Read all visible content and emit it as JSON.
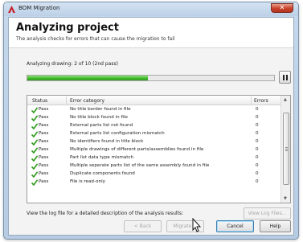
{
  "window": {
    "title": "BOM Migration",
    "close_glyph": "✕"
  },
  "header": {
    "title": "Analyzing project",
    "subtitle": "The analysis checks for errors that can cause the migration to fail"
  },
  "progress": {
    "label": "Analyzing drawing: 2 of 10 (2nd pass)",
    "fraction": 0.49
  },
  "table": {
    "columns": {
      "status": "Status",
      "category": "Error category",
      "errors": "Errors"
    },
    "rows": [
      {
        "status": "Pass",
        "category": "No title border found in file",
        "errors": "0"
      },
      {
        "status": "Pass",
        "category": "No title block found in file",
        "errors": "0"
      },
      {
        "status": "Pass",
        "category": "External parts list not found",
        "errors": "0"
      },
      {
        "status": "Pass",
        "category": "External parts list configuration mismatch",
        "errors": "0"
      },
      {
        "status": "Pass",
        "category": "No identifiers found in title block",
        "errors": "0"
      },
      {
        "status": "Pass",
        "category": "Multiple drawings of different parts/assemblies found in file",
        "errors": "0"
      },
      {
        "status": "Pass",
        "category": "Part list data type mismatch",
        "errors": "0"
      },
      {
        "status": "Pass",
        "category": "Multiple seperate parts list of the same assembly found in file",
        "errors": "0"
      },
      {
        "status": "Pass",
        "category": "Duplicate components found",
        "errors": "0"
      },
      {
        "status": "Pass",
        "category": "File is read-only",
        "errors": "0"
      }
    ]
  },
  "log": {
    "text": "View the log file for a detailed description of the analysis results:",
    "button": "View Log Files..."
  },
  "buttons": {
    "back": "< Back",
    "migrate": "Migrate >",
    "cancel": "Cancel",
    "help": "Help"
  },
  "icons": {
    "app": "autocad-logo-icon",
    "status_pass": "green-check-icon",
    "cursor": "mouse-pointer-icon",
    "pause": "pause-icon"
  },
  "colors": {
    "progress": "#3fb52a",
    "pass_check": "#2f9a1c",
    "app_icon": "#c8202a"
  }
}
